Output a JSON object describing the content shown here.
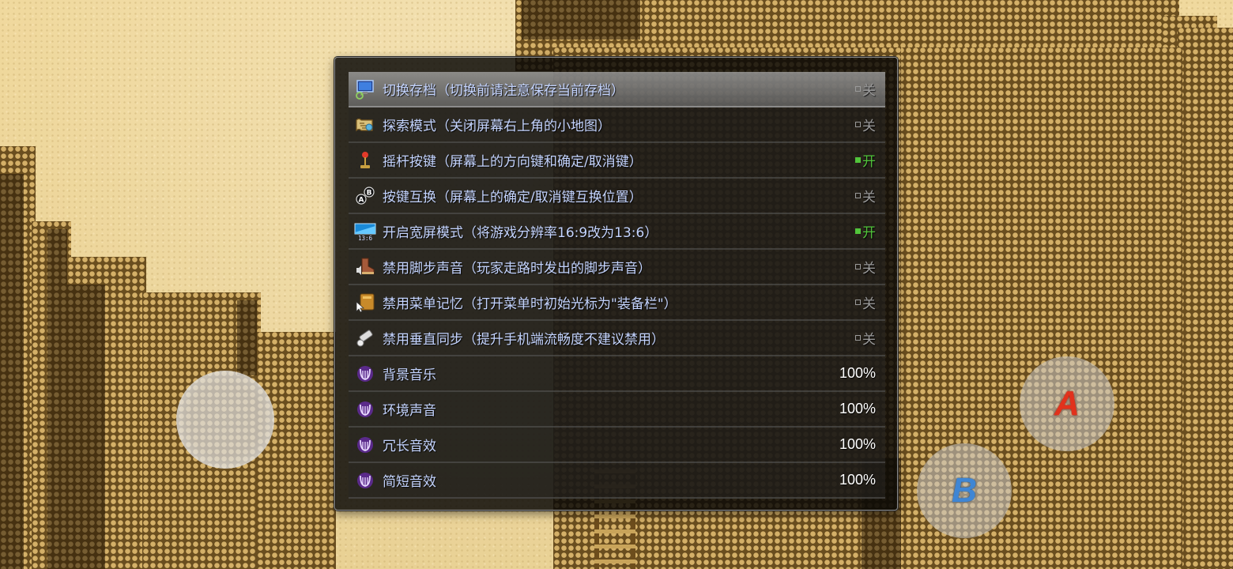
{
  "settings_menu": {
    "items": [
      {
        "icon": "computer-save-icon",
        "label": "切换存档（切换前请注意保存当前存档）",
        "value": "关",
        "state": "off",
        "selected": true
      },
      {
        "icon": "map-scroll-icon",
        "label": "探索模式（关闭屏幕右上角的小地图）",
        "value": "关",
        "state": "off",
        "selected": false
      },
      {
        "icon": "joystick-icon",
        "label": "摇杆按键（屏幕上的方向键和确定/取消键）",
        "value": "开",
        "state": "on",
        "selected": false
      },
      {
        "icon": "ab-swap-icon",
        "label": "按键互换（屏幕上的确定/取消键互换位置）",
        "value": "关",
        "state": "off",
        "selected": false
      },
      {
        "icon": "widescreen-icon",
        "label": "开启宽屏模式（将游戏分辨率16:9改为13:6）",
        "value": "开",
        "state": "on",
        "selected": false
      },
      {
        "icon": "boot-sound-icon",
        "label": "禁用脚步声音（玩家走路时发出的脚步声音）",
        "value": "关",
        "state": "off",
        "selected": false
      },
      {
        "icon": "book-cursor-icon",
        "label": "禁用菜单记忆（打开菜单时初始光标为\"装备栏\"）",
        "value": "关",
        "state": "off",
        "selected": false
      },
      {
        "icon": "vsync-icon",
        "label": "禁用垂直同步（提升手机端流畅度不建议禁用）",
        "value": "关",
        "state": "off",
        "selected": false
      },
      {
        "icon": "lyre-music-icon",
        "label": "背景音乐",
        "value": "100%",
        "state": "volume",
        "selected": false
      },
      {
        "icon": "lyre-music-icon",
        "label": "环境声音",
        "value": "100%",
        "state": "volume",
        "selected": false
      },
      {
        "icon": "lyre-music-icon",
        "label": "冗长音效",
        "value": "100%",
        "state": "volume",
        "selected": false
      },
      {
        "icon": "lyre-music-icon",
        "label": "简短音效",
        "value": "100%",
        "state": "volume",
        "selected": false
      }
    ],
    "widescreen_icon_text": "13:6"
  },
  "controls": {
    "a_button_label": "A",
    "b_button_label": "B"
  },
  "colors": {
    "label_text": "#c4d4ff",
    "on_state": "#51c43b",
    "off_state": "#9a9a9a",
    "volume_text": "#ffffff",
    "a_button": "#e2321c",
    "b_button": "#3f86d4"
  }
}
